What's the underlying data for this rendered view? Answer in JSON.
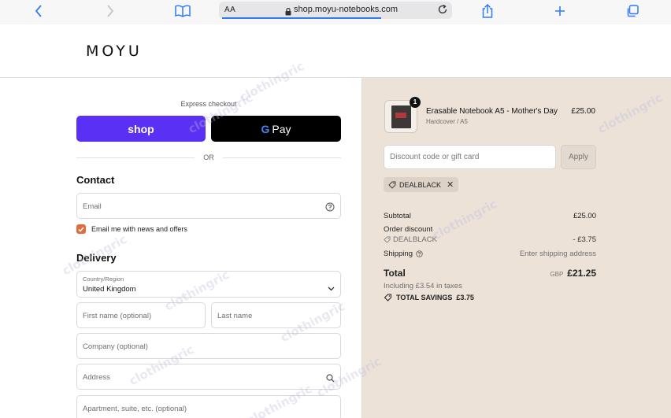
{
  "browser": {
    "text_size_label": "AA",
    "url": "shop.moyu-notebooks.com",
    "load_progress": 0.7
  },
  "header": {
    "logo": "MOYU"
  },
  "express": {
    "label": "Express checkout",
    "shop_label": "shop",
    "gpay_g": "G",
    "gpay_label": "Pay",
    "or_label": "OR"
  },
  "contact": {
    "title": "Contact",
    "email_placeholder": "Email",
    "newsletter_label": "Email me with news and offers",
    "newsletter_checked": true
  },
  "delivery": {
    "title": "Delivery",
    "country_label": "Country/Region",
    "country_value": "United Kingdom",
    "first_name_placeholder": "First name (optional)",
    "last_name_placeholder": "Last name",
    "company_placeholder": "Company (optional)",
    "address_placeholder": "Address",
    "apartment_placeholder": "Apartment, suite, etc. (optional)"
  },
  "summary": {
    "item": {
      "quantity": "1",
      "name": "Erasable Notebook A5 - Mother's Day",
      "variant": "Hardcover / A5",
      "price": "£25.00"
    },
    "discount_placeholder": "Discount code or gift card",
    "apply_label": "Apply",
    "applied_code": "DEALBLACK",
    "subtotal_label": "Subtotal",
    "subtotal_value": "£25.00",
    "order_discount_label": "Order discount",
    "discount_code": "DEALBLACK",
    "discount_value": "- £3.75",
    "shipping_label": "Shipping",
    "shipping_value": "Enter shipping address",
    "total_label": "Total",
    "currency": "GBP",
    "total_value": "£21.25",
    "taxes_note": "Including £3.54 in taxes",
    "savings_label": "TOTAL SAVINGS",
    "savings_value": "£3.75"
  },
  "watermark": "clothingric",
  "colors": {
    "shop_purple": "#5a31f4",
    "summary_bg": "#ece2d8",
    "checkbox": "#e06d3a",
    "browser_accent": "#2f7cf6"
  }
}
